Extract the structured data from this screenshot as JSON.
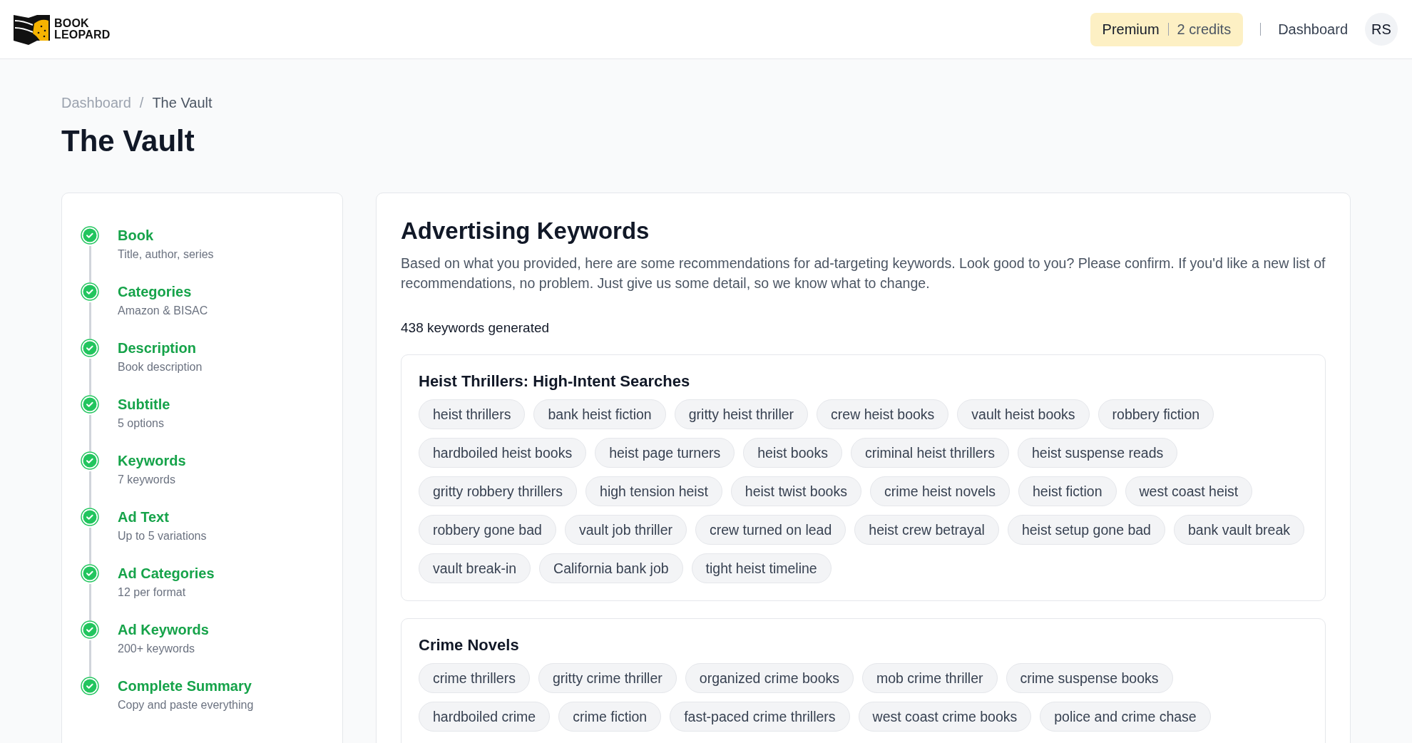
{
  "header": {
    "logo": {
      "line_1": "BOOK",
      "line_2": "LEOPARD"
    },
    "plan": "Premium",
    "credits": "2 credits",
    "nav_link": "Dashboard",
    "avatar": "RS"
  },
  "breadcrumb": [
    {
      "label": "Dashboard"
    },
    {
      "label": "The Vault"
    }
  ],
  "breadcrumb_separator": "/",
  "page_title": "The Vault",
  "steps": [
    {
      "title": "Book",
      "subtitle": "Title, author, series",
      "completed": true
    },
    {
      "title": "Categories",
      "subtitle": "Amazon & BISAC",
      "completed": true
    },
    {
      "title": "Description",
      "subtitle": "Book description",
      "completed": true
    },
    {
      "title": "Subtitle",
      "subtitle": "5 options",
      "completed": true
    },
    {
      "title": "Keywords",
      "subtitle": "7 keywords",
      "completed": true
    },
    {
      "title": "Ad Text",
      "subtitle": "Up to 5 variations",
      "completed": true
    },
    {
      "title": "Ad Categories",
      "subtitle": "12 per format",
      "completed": true
    },
    {
      "title": "Ad Keywords",
      "subtitle": "200+ keywords",
      "completed": true
    },
    {
      "title": "Complete Summary",
      "subtitle": "Copy and paste everything",
      "completed": true
    }
  ],
  "main": {
    "title": "Advertising Keywords",
    "description": "Based on what you provided, here are some recommendations for ad-targeting keywords. Look good to you? Please confirm. If you'd like a new list of recommendations, no problem. Just give us some detail, so we know what to change.",
    "count": "438 keywords generated",
    "groups": [
      {
        "title": "Heist Thrillers: High-Intent Searches",
        "keywords": [
          "heist thrillers",
          "bank heist fiction",
          "gritty heist thriller",
          "crew heist books",
          "vault heist books",
          "robbery fiction",
          "hardboiled heist books",
          "heist page turners",
          "heist books",
          "criminal heist thrillers",
          "heist suspense reads",
          "gritty robbery thrillers",
          "high tension heist",
          "heist twist books",
          "crime heist novels",
          "heist fiction",
          "west coast heist",
          "robbery gone bad",
          "vault job thriller",
          "crew turned on lead",
          "heist crew betrayal",
          "heist setup gone bad",
          "bank vault break",
          "vault break-in",
          "California bank job",
          "tight heist timeline"
        ]
      },
      {
        "title": "Crime Novels",
        "keywords": [
          "crime thrillers",
          "gritty crime thriller",
          "organized crime books",
          "mob crime thriller",
          "crime suspense books",
          "hardboiled crime",
          "crime fiction",
          "fast-paced crime thrillers",
          "west coast crime books",
          "police and crime chase"
        ]
      }
    ]
  }
}
